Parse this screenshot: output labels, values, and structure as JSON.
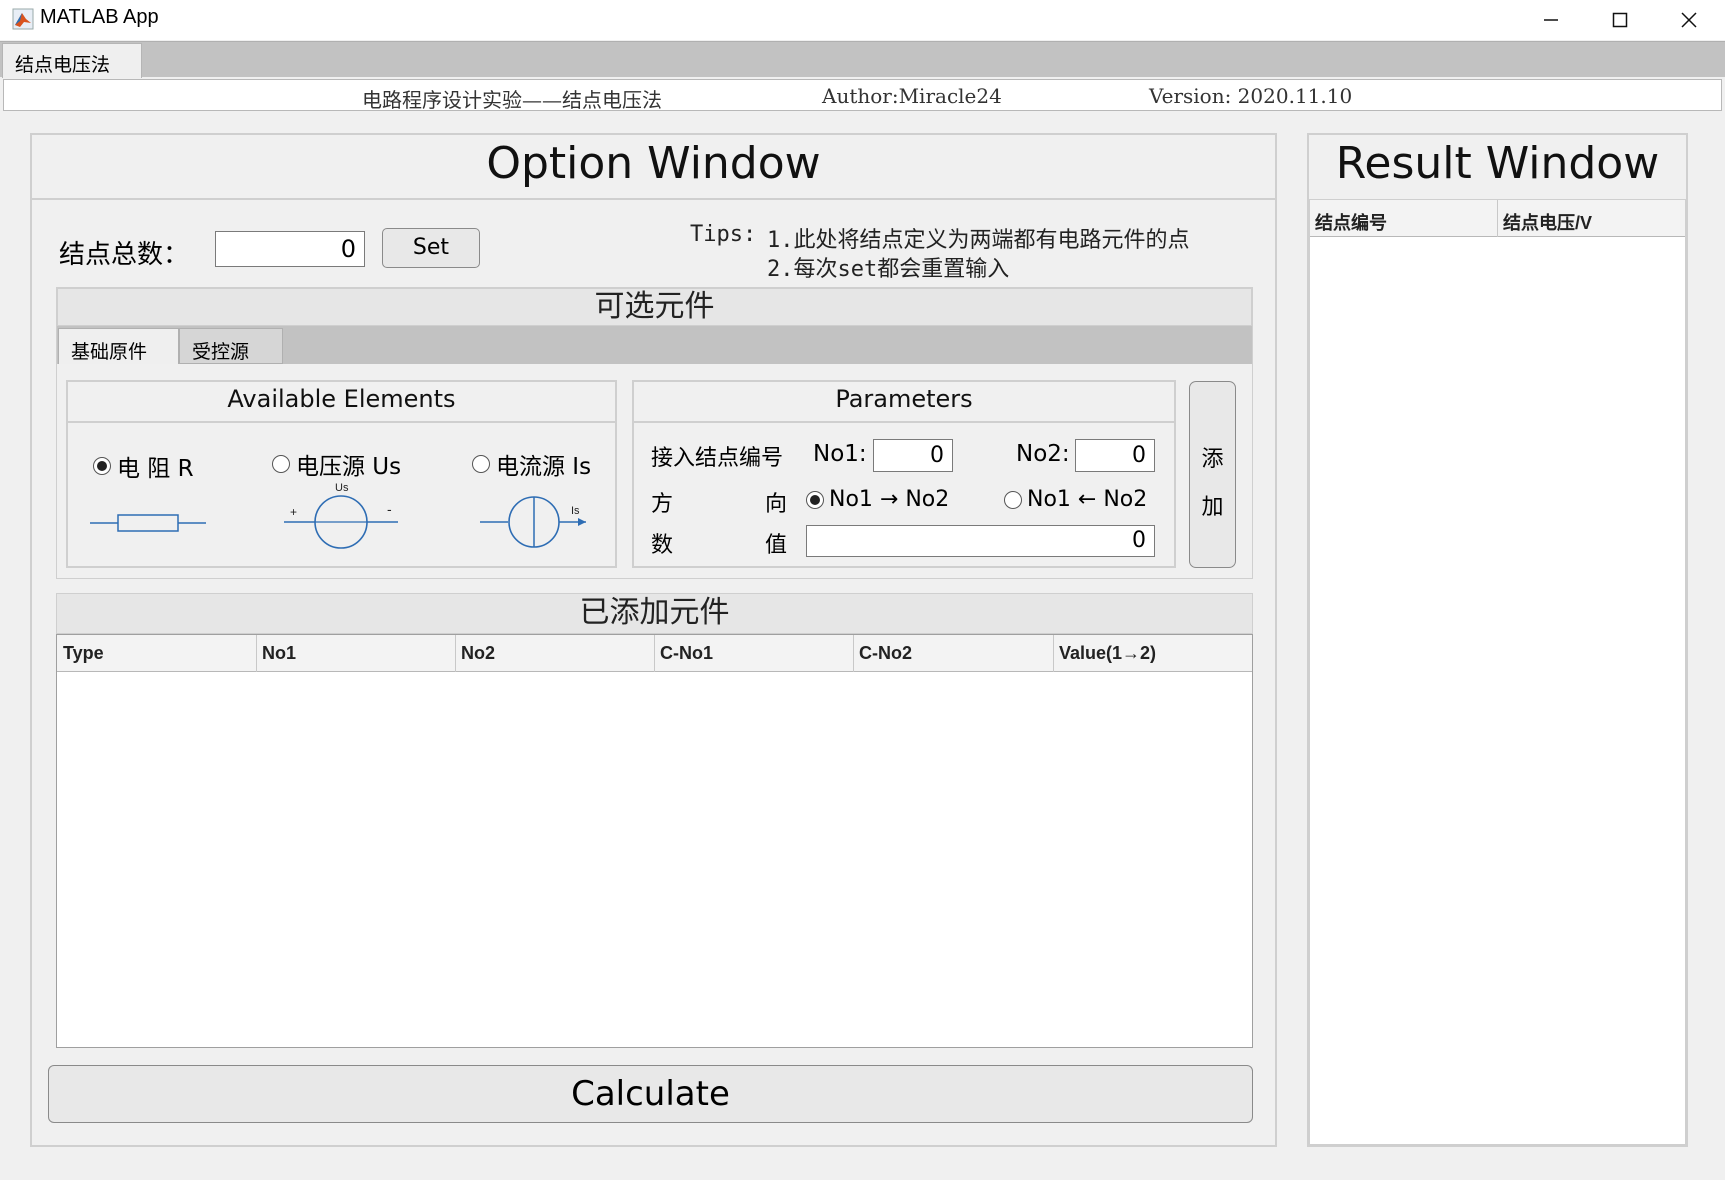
{
  "window": {
    "title": "MATLAB App",
    "minimize": "—",
    "maximize": "☐",
    "close": "✕"
  },
  "app_tab": "结点电压法",
  "header": {
    "title": "电路程序设计实验——结点电压法",
    "author": "Author:Miracle24",
    "version": "Version: 2020.11.10"
  },
  "option": {
    "title": "Option Window",
    "node_count_label": "结点总数：",
    "node_count_value": "0",
    "set_button": "Set",
    "tips_prefix": "Tips:",
    "tip1": "1.此处将结点定义为两端都有电路元件的点",
    "tip2": "2.每次set都会重置输入",
    "selectable": {
      "title": "可选元件",
      "tabs": [
        "基础原件",
        "受控源"
      ],
      "available": {
        "title": "Available Elements",
        "options": [
          "电 阻 R",
          "电压源 Us",
          "电流源 Is"
        ],
        "selected_index": 0,
        "symbol_labels": {
          "us_plus": "+",
          "us_minus": "-",
          "us_name": "Us",
          "is_name": "Is"
        }
      },
      "parameters": {
        "title": "Parameters",
        "node_label": "接入结点编号",
        "no1_label": "No1:",
        "no1_value": "0",
        "no2_label": "No2:",
        "no2_value": "0",
        "dir_label_1": "方",
        "dir_label_2": "向",
        "dir_opt1": "No1 → No2",
        "dir_opt2": "No1 ← No2",
        "val_label_1": "数",
        "val_label_2": "值",
        "value": "0"
      },
      "add_button": [
        "添",
        "加"
      ]
    },
    "added": {
      "title": "已添加元件",
      "columns": [
        "Type",
        "No1",
        "No2",
        "C-No1",
        "C-No2",
        "Value(1→2)"
      ]
    },
    "calculate_button": "Calculate"
  },
  "result": {
    "title": "Result Window",
    "columns": [
      "结点编号",
      "结点电压/V"
    ]
  }
}
